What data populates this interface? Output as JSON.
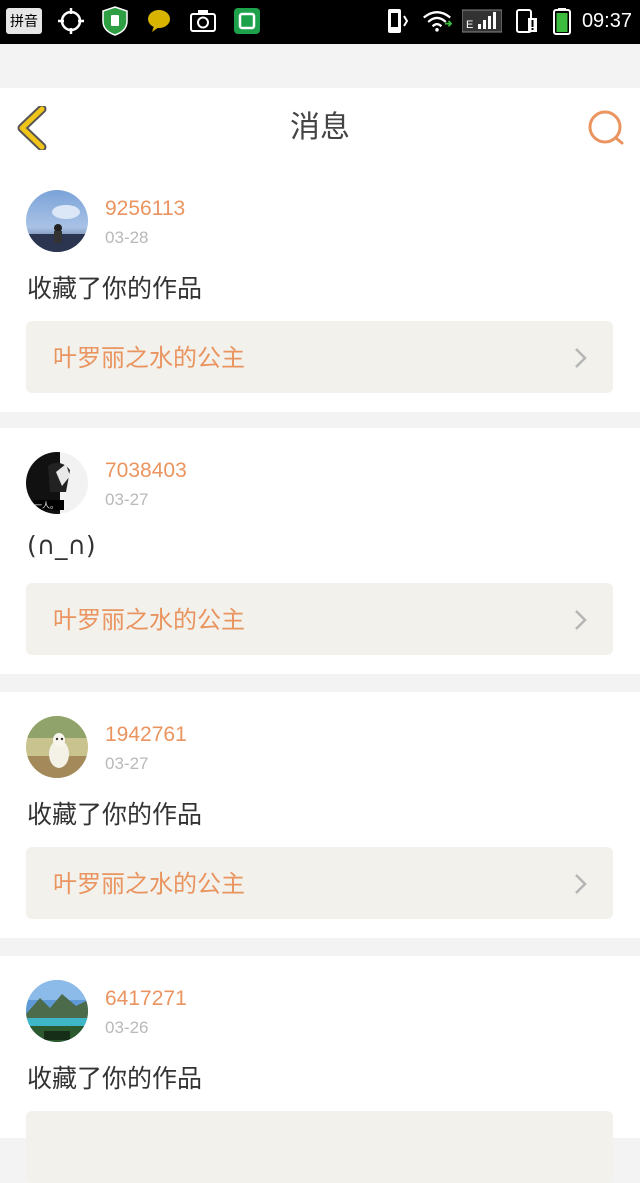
{
  "status_bar": {
    "ime_label": "拼音",
    "time": "09:37",
    "network_label": "E"
  },
  "header": {
    "title": "消息"
  },
  "messages": [
    {
      "user": "9256113",
      "date": "03-28",
      "text": "收藏了你的作品",
      "work": "叶罗丽之水的公主"
    },
    {
      "user": "7038403",
      "date": "03-27",
      "text": "(∩_∩)",
      "work": "叶罗丽之水的公主"
    },
    {
      "user": "1942761",
      "date": "03-27",
      "text": "收藏了你的作品",
      "work": "叶罗丽之水的公主"
    },
    {
      "user": "6417271",
      "date": "03-26",
      "text": "收藏了你的作品",
      "work": ""
    }
  ],
  "colors": {
    "accent": "#ea9460",
    "back_icon": "#f0c419",
    "card_link_bg": "#f2f1ec"
  }
}
